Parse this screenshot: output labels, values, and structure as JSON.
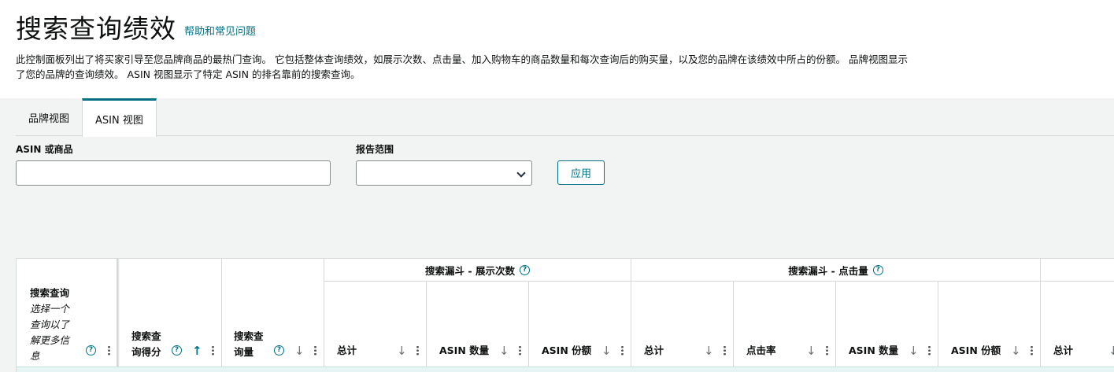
{
  "header": {
    "title": "搜索查询绩效",
    "help_link": "帮助和常见问题",
    "description": "此控制面板列出了将买家引导至您品牌商品的最热门查询。 它包括整体查询绩效，如展示次数、点击量、加入购物车的商品数量和每次查询后的购买量，以及您的品牌在该绩效中所占的份额。 品牌视图显示了您的品牌的查询绩效。 ASIN 视图显示了特定 ASIN 的排名靠前的搜索查询。"
  },
  "tabs": [
    {
      "label": "品牌视图",
      "active": false
    },
    {
      "label": "ASIN 视图",
      "active": true
    }
  ],
  "filters": {
    "asin_label": "ASIN 或商品",
    "asin_value": "",
    "range_label": "报告范围",
    "range_value": "",
    "apply_label": "应用"
  },
  "table": {
    "col_query": {
      "title": "搜索查询",
      "hint_lines": [
        "选择一个",
        "查询以了",
        "解更多信",
        "息"
      ]
    },
    "col_score": {
      "lines": [
        "搜索查",
        "询得分"
      ]
    },
    "col_volume": {
      "lines": [
        "搜索查",
        "询量"
      ]
    },
    "groups": [
      {
        "label": "搜索漏斗 - 展示次数",
        "subs": [
          "总计",
          "ASIN 数量",
          "ASIN 份额"
        ]
      },
      {
        "label": "搜索漏斗 - 点击量",
        "subs": [
          "总计",
          "点击率",
          "ASIN 数量",
          "ASIN 份额"
        ]
      }
    ],
    "next_sub": "总计"
  },
  "colors": {
    "accent": "#007185",
    "panel_bg": "#f2f3f3",
    "border": "#d5d9d9"
  }
}
